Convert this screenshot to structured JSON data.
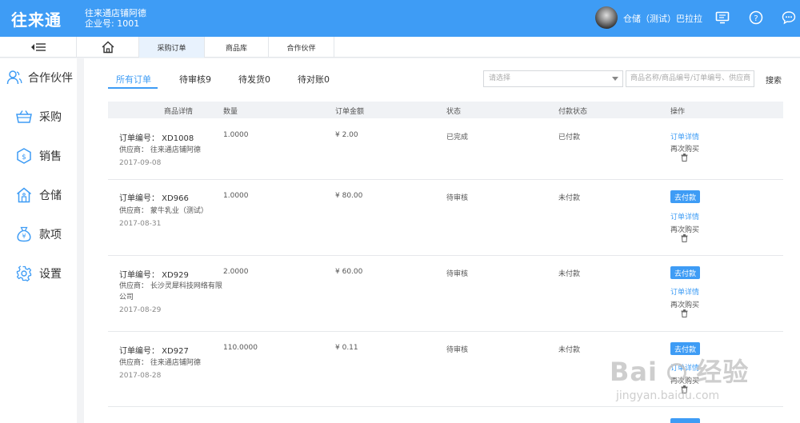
{
  "header": {
    "logo": "往来通",
    "shop_name": "往来通店铺阿德",
    "enterprise": "企业号: 1001",
    "username": "仓储（测试）巴拉拉"
  },
  "nav_tabs": [
    {
      "label": "采购订单",
      "active": true
    },
    {
      "label": "商品库",
      "active": false
    },
    {
      "label": "合作伙伴",
      "active": false
    }
  ],
  "sidebar": {
    "items": [
      {
        "label": "合作伙伴",
        "icon": "partner-icon"
      },
      {
        "label": "采购",
        "icon": "basket-icon"
      },
      {
        "label": "销售",
        "icon": "sales-icon"
      },
      {
        "label": "仓储",
        "icon": "warehouse-icon"
      },
      {
        "label": "款项",
        "icon": "money-bag-icon"
      },
      {
        "label": "设置",
        "icon": "gear-icon"
      }
    ]
  },
  "filter_tabs": [
    {
      "label": "所有订单",
      "active": true
    },
    {
      "label": "待审核9",
      "active": false
    },
    {
      "label": "待发货0",
      "active": false
    },
    {
      "label": "待对账0",
      "active": false
    }
  ],
  "filters": {
    "select_placeholder": "请选择",
    "search_placeholder": "商品名称/商品编号/订单编号、供应商",
    "search_button": "搜索"
  },
  "table": {
    "headers": [
      "商品详情",
      "数量",
      "订单金额",
      "状态",
      "付款状态",
      "操作"
    ],
    "rows": [
      {
        "order_no": "订单编号： XD1008",
        "supplier": "供应商： 往来通店铺阿德",
        "date": "2017-09-08",
        "qty": "1.0000",
        "amount": "¥ 2.00",
        "status": "已完成",
        "pay_status": "已付款",
        "pay_button": "",
        "detail": "订单详情",
        "rebuy": "再次购买"
      },
      {
        "order_no": "订单编号： XD966",
        "supplier": "供应商： 蒙牛乳业（测试）",
        "date": "2017-08-31",
        "qty": "1.0000",
        "amount": "¥ 80.00",
        "status": "待审核",
        "pay_status": "未付款",
        "pay_button": "去付款",
        "detail": "订单详情",
        "rebuy": "再次购买"
      },
      {
        "order_no": "订单编号： XD929",
        "supplier": "供应商： 长沙灵犀科技网络有限公司",
        "date": "2017-08-29",
        "qty": "2.0000",
        "amount": "¥ 60.00",
        "status": "待审核",
        "pay_status": "未付款",
        "pay_button": "去付款",
        "detail": "订单详情",
        "rebuy": "再次购买"
      },
      {
        "order_no": "订单编号： XD927",
        "supplier": "供应商： 往来通店铺阿德",
        "date": "2017-08-28",
        "qty": "110.0000",
        "amount": "¥ 0.11",
        "status": "待审核",
        "pay_status": "未付款",
        "pay_button": "去付款",
        "detail": "订单详情",
        "rebuy": "再次购买"
      }
    ]
  },
  "watermark": {
    "brand": "Bai",
    "brand2": "经验",
    "url": "jingyan.baidu.com"
  },
  "colors": {
    "accent": "#3e9cf5"
  }
}
